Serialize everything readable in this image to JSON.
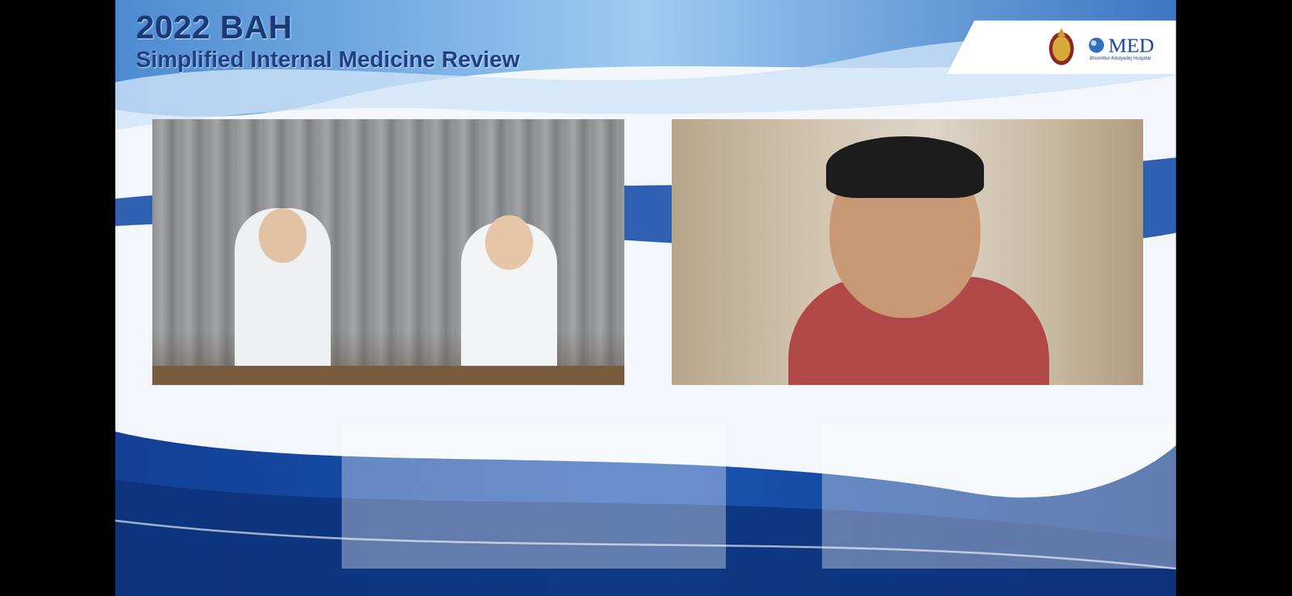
{
  "header": {
    "title": "2022 BAH",
    "subtitle": "Simplified Internal Medicine Review"
  },
  "logo": {
    "text": "MED",
    "caption": "Bhumibol Adulyadej Hospital"
  }
}
